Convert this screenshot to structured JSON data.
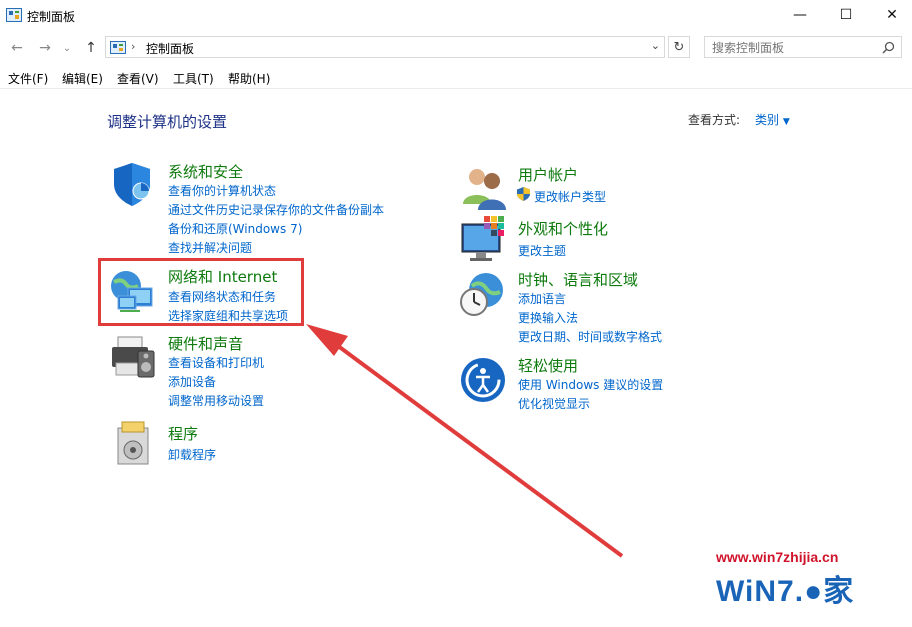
{
  "window": {
    "title": "控制面板",
    "minimize": "—",
    "maximize": "☐",
    "close": "✕"
  },
  "nav": {
    "back": "←",
    "forward": "→",
    "recent": "⌄",
    "up": "↑",
    "refresh": "↻"
  },
  "address": {
    "separator": "›",
    "path": "控制面板",
    "dropdown": "⌄"
  },
  "search": {
    "placeholder": "搜索控制面板",
    "icon": "search-icon"
  },
  "menubar": [
    "文件(F)",
    "编辑(E)",
    "查看(V)",
    "工具(T)",
    "帮助(H)"
  ],
  "main": {
    "heading": "调整计算机的设置",
    "view_by_label": "查看方式:",
    "view_by_value": "类别",
    "left_categories": [
      {
        "title": "系统和安全",
        "icon": "shield-icon",
        "links": [
          "查看你的计算机状态",
          "通过文件历史记录保存你的文件备份副本",
          "备份和还原(Windows 7)",
          "查找并解决问题"
        ]
      },
      {
        "title": "网络和 Internet",
        "icon": "network-icon",
        "links": [
          "查看网络状态和任务",
          "选择家庭组和共享选项"
        ]
      },
      {
        "title": "硬件和声音",
        "icon": "printer-icon",
        "links": [
          "查看设备和打印机",
          "添加设备",
          "调整常用移动设置"
        ]
      },
      {
        "title": "程序",
        "icon": "programs-icon",
        "links": [
          "卸载程序"
        ]
      }
    ],
    "right_categories": [
      {
        "title": "用户帐户",
        "icon": "users-icon",
        "links": [
          "更改帐户类型"
        ]
      },
      {
        "title": "外观和个性化",
        "icon": "appearance-icon",
        "links": [
          "更改主题"
        ]
      },
      {
        "title": "时钟、语言和区域",
        "icon": "clock-globe-icon",
        "links": [
          "添加语言",
          "更换输入法",
          "更改日期、时间或数字格式"
        ]
      },
      {
        "title": "轻松使用",
        "icon": "ease-of-access-icon",
        "links": [
          "使用 Windows 建议的设置",
          "优化视觉显示"
        ]
      }
    ]
  },
  "watermark": {
    "url": "www.win7zhijia.cn",
    "logo": "WiN7.●家"
  },
  "colors": {
    "accent_link": "#0066cc",
    "category_title": "#0e7a0d",
    "heading": "#1e3287",
    "highlight_box": "#e03c3c",
    "arrow": "#e03c3c"
  }
}
